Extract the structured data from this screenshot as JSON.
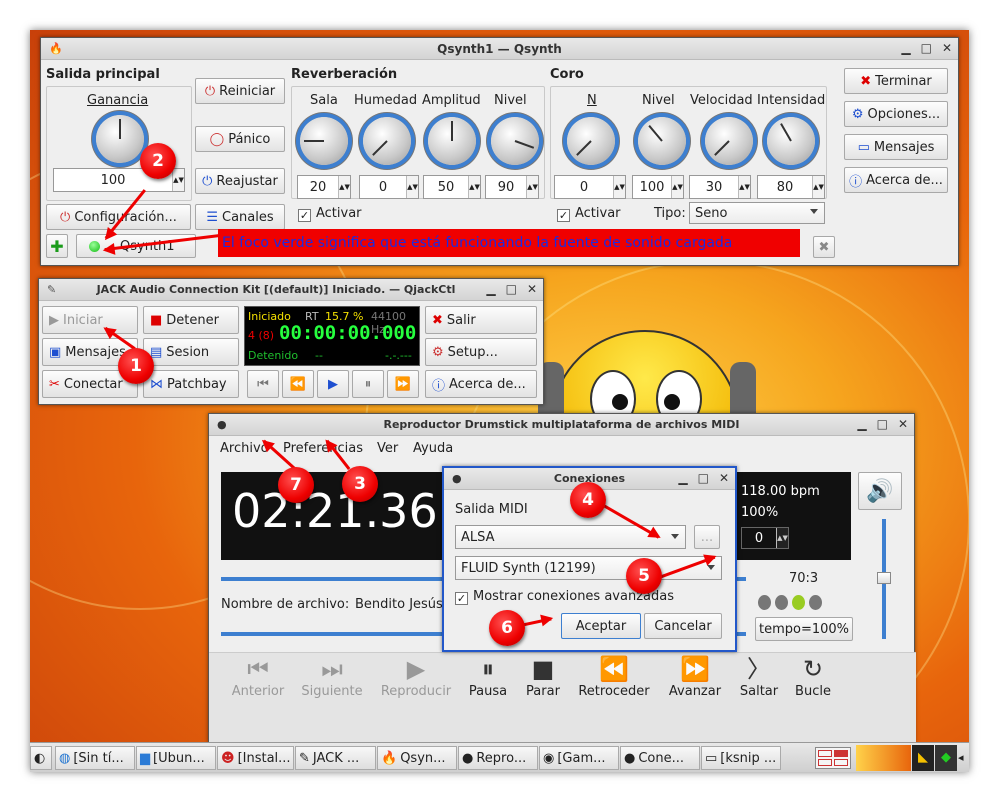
{
  "qsynth": {
    "title": "Qsynth1 — Qsynth",
    "main_output": "Salida principal",
    "gain_label": "Ganancia",
    "gain_value": "100",
    "restart": "Reiniciar",
    "panic": "Pánico",
    "adjust": "Reajustar",
    "config": "Configuración...",
    "channels": "Canales",
    "reverb_title": "Reverberación",
    "reverb_labels": [
      "Sala",
      "Humedad",
      "Amplitud",
      "Nivel"
    ],
    "reverb_values": [
      "20",
      "0",
      "50",
      "90"
    ],
    "reverb_activate": "Activar",
    "chorus_title": "Coro",
    "chorus_labels": [
      "N",
      "Nivel",
      "Velocidad",
      "Intensidad"
    ],
    "chorus_values": [
      "0",
      "100",
      "30",
      "80"
    ],
    "chorus_activate": "Activar",
    "type_label": "Tipo:",
    "type_value": "Seno",
    "quit": "Terminar",
    "options": "Opciones...",
    "messages": "Mensajes",
    "about": "Acerca de...",
    "tab_name": "Qsynth1",
    "annotation": "El foco verde significa que está funcionando la fuente de sonido cargada"
  },
  "qjackctl": {
    "title": "JACK Audio Connection Kit [(default)] Iniciado. — QjackCtl",
    "start": "Iniciar",
    "stop": "Detener",
    "quit": "Salir",
    "messages": "Mensajes",
    "session": "Sesion",
    "setup": "Setup...",
    "connect": "Conectar",
    "patchbay": "Patchbay",
    "about": "Acerca de...",
    "status": "Iniciado",
    "rt": "RT",
    "dsp": "15.7 %",
    "rate": "44100 Hz",
    "xruns": "4 (8)",
    "time": "00:00:00.000",
    "transport": "Detenido",
    "dashes": "--",
    "dashes2": "-.-.---"
  },
  "drumstick": {
    "title": "Reproductor Drumstick multiplataforma de archivos MIDI",
    "menu": [
      "Archivo",
      "Preferencias",
      "Ver",
      "Ayuda"
    ],
    "time": "02:21.36",
    "bpm": "118.00 bpm",
    "percent": "100%",
    "pitch": "0",
    "file_label": "Nombre de archivo:",
    "file_value": "Bendito Jesús",
    "ratio": "70:3",
    "tempo_button": "tempo=100%",
    "controls": [
      "Anterior",
      "Siguiente",
      "Reproducir",
      "Pausa",
      "Parar",
      "Retroceder",
      "Avanzar",
      "Saltar",
      "Bucle"
    ]
  },
  "connections": {
    "title": "Conexiones",
    "midi_out_label": "Salida MIDI",
    "driver": "ALSA",
    "more": "...",
    "port": "FLUID Synth (12199)",
    "advanced": "Mostrar conexiones avanzadas",
    "accept": "Aceptar",
    "cancel": "Cancelar"
  },
  "badges": [
    "1",
    "2",
    "3",
    "4",
    "5",
    "6",
    "7"
  ],
  "taskbar": [
    "[Sin tí...",
    "[Ubun...",
    "[Instal...",
    "JACK ...",
    "Qsyn...",
    "Repro...",
    "[Gam...",
    "Cone...",
    "[ksnip ..."
  ],
  "colors": {
    "accent": "#3d7fd0",
    "badge": "#e00000",
    "annotation_bg": "#f00000",
    "annotation_text": "#1b2be0",
    "lcd_time": "#26ff3e"
  }
}
